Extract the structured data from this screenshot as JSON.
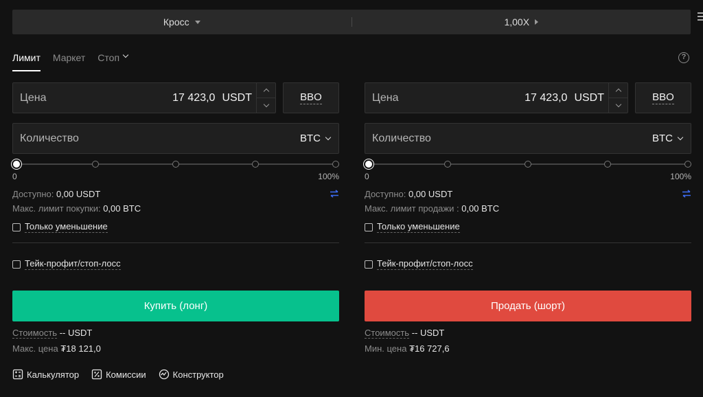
{
  "topbar": {
    "margin_mode": "Кросс",
    "leverage": "1,00X"
  },
  "tabs": [
    {
      "label": "Лимит",
      "active": true
    },
    {
      "label": "Маркет",
      "active": false
    },
    {
      "label": "Стоп",
      "active": false
    }
  ],
  "buy": {
    "price_label": "Цена",
    "price_value": "17 423,0",
    "price_unit": "USDT",
    "bbo_label": "BBO",
    "qty_label": "Количество",
    "qty_currency": "BTC",
    "slider_min": "0",
    "slider_max": "100%",
    "slider_value": 0,
    "available_label": "Доступно:",
    "available_value": "0,00 USDT",
    "max_limit_label": "Макс. лимит покупки:",
    "max_limit_value": "0,00 BTC",
    "reduce_only_label": "Только уменьшение",
    "tp_sl_label": "Тейк-профит/стоп-лосс",
    "action_label": "Купить (лонг)",
    "cost_label": "Стоимость",
    "cost_value": "-- USDT",
    "limit_price_label": "Макс. цена",
    "limit_price_value": "₮18 121,0"
  },
  "sell": {
    "price_label": "Цена",
    "price_value": "17 423,0",
    "price_unit": "USDT",
    "bbo_label": "BBO",
    "qty_label": "Количество",
    "qty_currency": "BTC",
    "slider_min": "0",
    "slider_max": "100%",
    "slider_value": 0,
    "available_label": "Доступно:",
    "available_value": "0,00 USDT",
    "max_limit_label": "Макс. лимит продажи :",
    "max_limit_value": "0,00 BTC",
    "reduce_only_label": "Только уменьшение",
    "tp_sl_label": "Тейк-профит/стоп-лосс",
    "action_label": "Продать (шорт)",
    "cost_label": "Стоимость",
    "cost_value": "-- USDT",
    "limit_price_label": "Мин. цена",
    "limit_price_value": "₮16 727,6"
  },
  "tools": {
    "calculator": "Калькулятор",
    "fees": "Комиссии",
    "constructor": "Конструктор"
  },
  "colors": {
    "buy": "#07c18d",
    "sell": "#e04a3f",
    "swap_icon": "#3d6cf2"
  },
  "icons": {
    "menu": "hamburger-icon",
    "help": "question-circle-icon",
    "swap": "swap-arrows-icon",
    "calculator": "calculator-icon",
    "fees": "percent-icon",
    "constructor": "strategy-icon"
  }
}
